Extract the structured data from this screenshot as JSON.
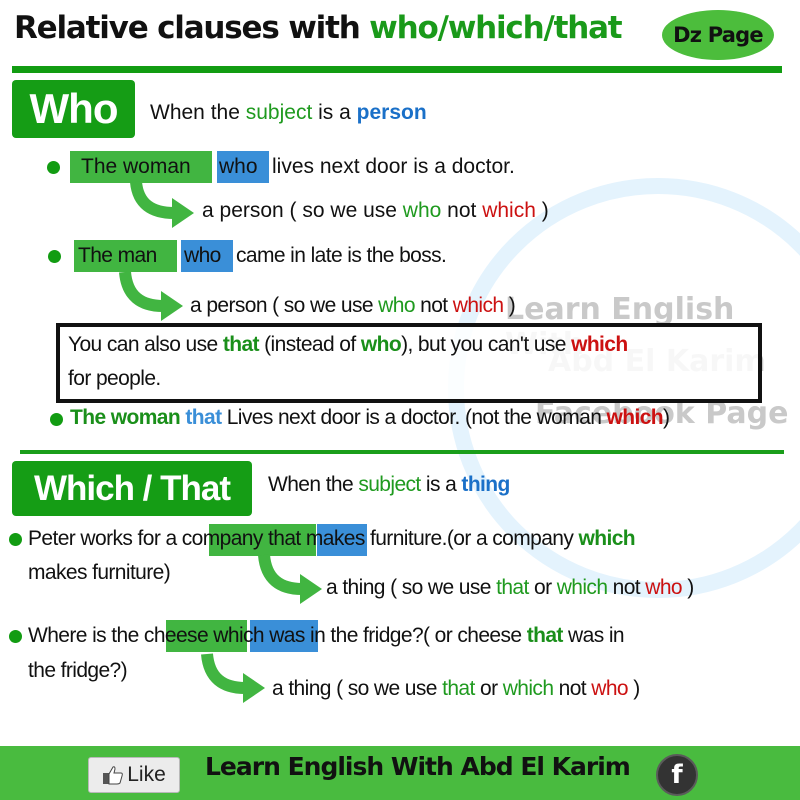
{
  "header": {
    "title_prefix": "Relative clauses with ",
    "title_highlight": "who/which/that",
    "badge": "Dz Page"
  },
  "watermark": {
    "line1": "Learn English With",
    "line2": "Abd El Karim",
    "line3": "Facebook Page"
  },
  "who_section": {
    "tag": "Who",
    "intro": {
      "pre": "When the ",
      "subject": "subject",
      "mid": " is a ",
      "kind": "person"
    },
    "examples": [
      {
        "antecedent": "The woman",
        "pronoun": "who",
        "rest": "lives next door is a doctor.",
        "explain": {
          "pre": "a person ( so we use ",
          "use": "who",
          "mid": " not ",
          "not": "which",
          "post": " )"
        }
      },
      {
        "antecedent": "The man",
        "pronoun": "who",
        "rest": "came in late is the boss.",
        "explain": {
          "pre": "a person ( so we use ",
          "use": "who",
          "mid": " not ",
          "not": "which",
          "post": " )"
        }
      }
    ],
    "note": {
      "p1": "You can also use ",
      "that": "that",
      "p2": " (instead of ",
      "who": "who",
      "p3": "), but you can't use ",
      "which": "which",
      "line2": "for people."
    },
    "extra_example": {
      "subject": "The woman",
      "pronoun": "that",
      "rest": " Lives next door is a doctor. (not the woman ",
      "wrong": "which",
      "close": ")"
    }
  },
  "which_section": {
    "tag": "Which / That",
    "intro": {
      "pre": "When the ",
      "subject": "subject",
      "mid": " is a ",
      "kind": "thing"
    },
    "examples": [
      {
        "pre": "Peter works for a ",
        "antecedent": "company",
        "pronoun": "that",
        "rest": " makes furniture.(or a company ",
        "alt": "which",
        "line2": "makes furniture)",
        "explain": {
          "pre": "a thing ( so we use ",
          "use1": "that",
          "or": " or ",
          "use2": "which",
          "mid": " not ",
          "not": "who",
          "post": " )"
        }
      },
      {
        "pre": "Where is the ",
        "antecedent": "cheese",
        "pronoun": "which",
        "rest": " was in the fridge?( or cheese ",
        "alt": "that",
        "rest2": " was in",
        "line2": "the fridge?)",
        "explain": {
          "pre": "a thing ( so we use ",
          "use1": "that",
          "or": " or ",
          "use2": "which",
          "mid": " not ",
          "not": "who",
          "post": " )"
        }
      }
    ]
  },
  "footer": {
    "like_label": "Like",
    "title": "Learn English With Abd El Karim",
    "fb_glyph": "f"
  },
  "colors": {
    "brand_green": "#129c12",
    "highlight_green": "#41b541",
    "highlight_blue": "#3a8fd8",
    "accent_blue": "#1a70c8",
    "wrong_red": "#cc1111",
    "footer_green": "#49bb3f"
  }
}
